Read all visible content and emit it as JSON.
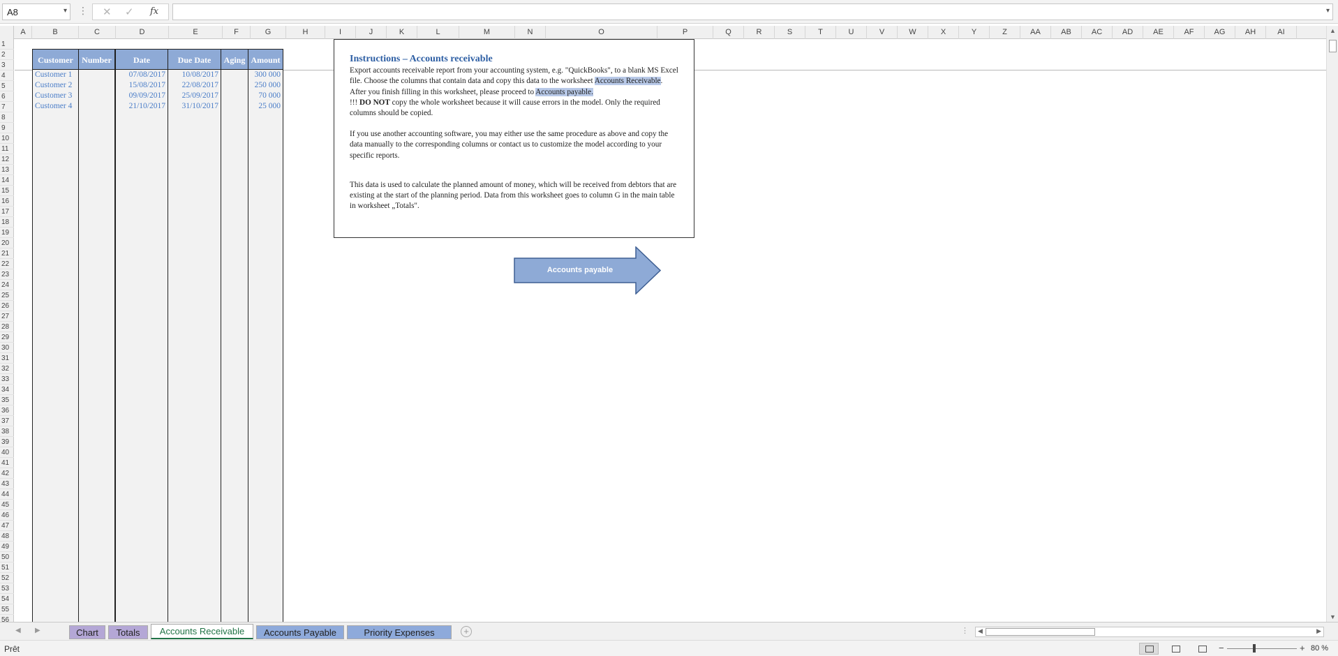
{
  "formula_bar": {
    "name_box": "A8",
    "formula": "",
    "fx_label": "fx"
  },
  "columns": [
    "A",
    "B",
    "C",
    "D",
    "E",
    "F",
    "G",
    "H",
    "I",
    "J",
    "K",
    "L",
    "M",
    "N",
    "O",
    "P",
    "Q",
    "R",
    "S",
    "T",
    "U",
    "V",
    "W",
    "X",
    "Y",
    "Z",
    "AA",
    "AB",
    "AC",
    "AD",
    "AE",
    "AF",
    "AG",
    "AH",
    "AI"
  ],
  "table": {
    "headers": [
      "Customer",
      "Number",
      "Date",
      "Due Date",
      "Aging",
      "Amount"
    ],
    "rows": [
      {
        "customer": "Customer 1",
        "date": "07/08/2017",
        "due": "10/08/2017",
        "amount": "300 000"
      },
      {
        "customer": "Customer 2",
        "date": "15/08/2017",
        "due": "22/08/2017",
        "amount": "250 000"
      },
      {
        "customer": "Customer 3",
        "date": "09/09/2017",
        "due": "25/09/2017",
        "amount": "70 000"
      },
      {
        "customer": "Customer 4",
        "date": "21/10/2017",
        "due": "31/10/2017",
        "amount": "25 000"
      }
    ]
  },
  "instructions": {
    "title": "Instructions – Accounts receivable",
    "p1_a": "Export accounts receivable report from your accounting system, e.g. \"QuickBooks\", to a blank MS Excel file. Choose the columns that contain data and copy this data to the worksheet ",
    "p1_link": "Accounts Receivable",
    "p1_b": ".",
    "p2_a": "After you finish filling in this worksheet, please proceed to ",
    "p2_link": "Accounts payable.",
    "p3_prefix": "!!! ",
    "p3_bold": "DO NOT",
    "p3_rest": " copy the whole worksheet because it will cause errors in the model. Only the required columns should be copied.",
    "p4": "If you use another accounting software, you may either use the same procedure as above and copy the data manually to the corresponding columns or contact us to customize the model according to your specific reports.",
    "p5": "This data is used to calculate the planned amount of money, which will be received from debtors that are existing at the start of the planning period. Data from this worksheet goes to column G in the main table in worksheet „Totals\"."
  },
  "arrow_button": {
    "label": "Accounts payable"
  },
  "sheet_tabs": [
    {
      "label": "Chart",
      "color": "#b4a7d6"
    },
    {
      "label": "Totals",
      "color": "#b4a7d6"
    },
    {
      "label": "Accounts Receivable",
      "color": "#ffffff",
      "active": true
    },
    {
      "label": "Accounts Payable",
      "color": "#8eaadb"
    },
    {
      "label": "Priority Expenses",
      "color": "#8eaadb"
    }
  ],
  "status": {
    "text": "Prêt",
    "zoom": "80 %"
  },
  "colors": {
    "header_fill": "#8eaad6",
    "data_text": "#4a7dc8",
    "title": "#2e5fa4",
    "active_tab": "#217346"
  }
}
